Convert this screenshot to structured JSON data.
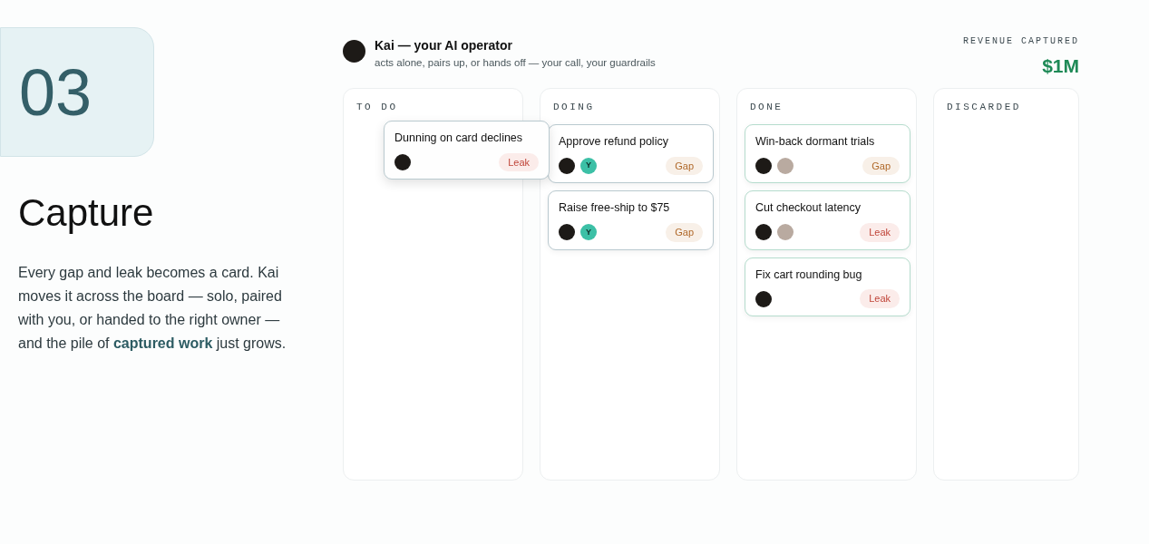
{
  "step": {
    "number": "03",
    "title": "Capture",
    "description": "Every gap and leak becomes a card. Kai moves it across the board — solo, paired with you, or handed to the right owner — and the pile of **captured work** just grows."
  },
  "operator": {
    "name": "Kai — your AI operator",
    "subtitle": "acts alone, pairs up, or hands off — your call, your guardrails"
  },
  "revenue": {
    "label": "REVENUE CAPTURED",
    "value": "$1M"
  },
  "columns": [
    {
      "title": "TO DO",
      "cards": [
        {
          "title": "Dunning on card declines",
          "moving": true,
          "done": false,
          "avatars": [
            {
              "kind": "kai"
            }
          ],
          "tag": {
            "kind": "leak",
            "label": "Leak"
          }
        }
      ]
    },
    {
      "title": "DOING",
      "cards": [
        {
          "title": "Approve refund policy",
          "moving": false,
          "done": false,
          "avatars": [
            {
              "kind": "kai"
            },
            {
              "kind": "initial",
              "label": "Y"
            }
          ],
          "tag": {
            "kind": "gap",
            "label": "Gap"
          }
        },
        {
          "title": "Raise free-ship to $75",
          "moving": false,
          "done": false,
          "avatars": [
            {
              "kind": "kai"
            },
            {
              "kind": "initial",
              "label": "Y"
            }
          ],
          "tag": {
            "kind": "gap",
            "label": "Gap"
          }
        }
      ]
    },
    {
      "title": "DONE",
      "cards": [
        {
          "title": "Win-back dormant trials",
          "moving": false,
          "done": true,
          "avatars": [
            {
              "kind": "kai"
            },
            {
              "kind": "photo"
            }
          ],
          "tag": {
            "kind": "gap",
            "label": "Gap"
          }
        },
        {
          "title": "Cut checkout latency",
          "moving": false,
          "done": true,
          "avatars": [
            {
              "kind": "kai"
            },
            {
              "kind": "photo"
            }
          ],
          "tag": {
            "kind": "leak",
            "label": "Leak"
          }
        },
        {
          "title": "Fix cart rounding bug",
          "moving": false,
          "done": true,
          "avatars": [
            {
              "kind": "kai"
            }
          ],
          "tag": {
            "kind": "leak",
            "label": "Leak"
          }
        }
      ]
    },
    {
      "title": "DISCARDED"
    }
  ]
}
